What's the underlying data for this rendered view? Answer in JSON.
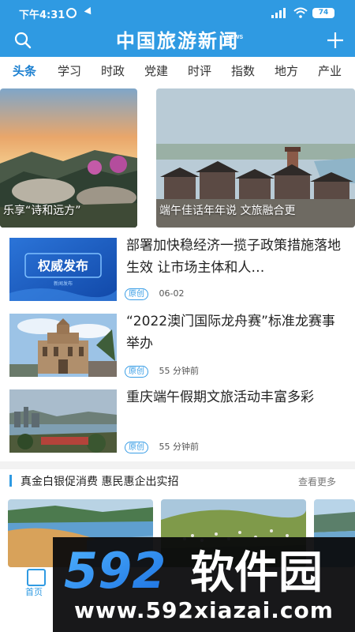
{
  "status_bar": {
    "time": "下午4:31",
    "battery": "74"
  },
  "header": {
    "logo_text": "中国旅游新闻",
    "logo_badge": "NEWS"
  },
  "tabs": [
    {
      "label": "头条",
      "active": true
    },
    {
      "label": "学习",
      "active": false
    },
    {
      "label": "时政",
      "active": false
    },
    {
      "label": "党建",
      "active": false
    },
    {
      "label": "时评",
      "active": false
    },
    {
      "label": "指数",
      "active": false
    },
    {
      "label": "地方",
      "active": false
    },
    {
      "label": "产业",
      "active": false
    }
  ],
  "carousel": [
    {
      "caption": "乐享“诗和远方”"
    },
    {
      "caption": "端午佳话年年说 文旅融合更"
    }
  ],
  "news": [
    {
      "title": "部署加快稳经济一揽子政策措施落地生效 让市场主体和人…",
      "badge": "原创",
      "time": "06-02",
      "thumb_text": "权威发布",
      "thumb_subtext": "新闻发布"
    },
    {
      "title": "“2022澳门国际龙舟赛”标准龙赛事举办",
      "badge": "原创",
      "time": "55 分钟前"
    },
    {
      "title": "重庆端午假期文旅活动丰富多彩",
      "badge": "原创",
      "time": "55 分钟前"
    }
  ],
  "section": {
    "title": "真金白银促消费 惠民惠企出实招",
    "more": "查看更多"
  },
  "bottom_nav": {
    "home_label": "首页"
  },
  "watermark": {
    "logo": "592软件园",
    "url": "www.592xiazai.com"
  },
  "colors": {
    "brand_blue": "#2f9ae2",
    "active_tab": "#1a7fd0",
    "badge_blue": "#3a9ee6"
  }
}
